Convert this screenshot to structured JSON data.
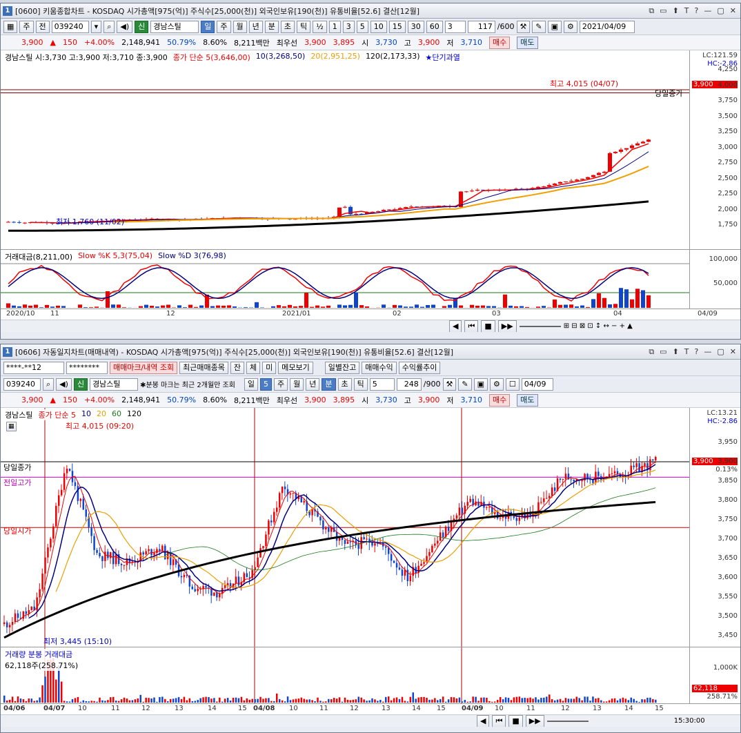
{
  "win1": {
    "num": "1",
    "title": "[0600] 키움종합차트 - KOSDAQ 시가총액[975(억)] 주식수[25,000(천)] 외국인보유[190(천)] 유통비율[52.6] 결산[12월]",
    "ctrl": [
      "⧉",
      "▭",
      "⬆",
      "T",
      "?",
      "—",
      "▢",
      "✕"
    ],
    "toolbar": {
      "type": "주",
      "sel": "전",
      "code": "039240",
      "stock": "경남스틸",
      "badge": "신",
      "periods": [
        "일",
        "주",
        "월",
        "년",
        "분",
        "초",
        "틱"
      ],
      "frac": "½",
      "nums": [
        "1",
        "3",
        "5",
        "10",
        "15",
        "30",
        "60"
      ],
      "num_sel": "3",
      "count": "117",
      "count_total": "/600",
      "date": "2021/04/09"
    },
    "quote": {
      "price": "3,900",
      "arrow": "▲",
      "change": "150",
      "pct": "+4.00%",
      "volume": "2,148,941",
      "rate1": "50.79%",
      "rate2": "8.60%",
      "amount": "8,211백만",
      "best_lbl": "최우선",
      "ask": "3,900",
      "bid": "3,895",
      "open_lbl": "시",
      "open": "3,730",
      "high_lbl": "고",
      "high": "3,900",
      "low_lbl": "저",
      "low": "3,710",
      "buy": "매수",
      "sell": "매도"
    },
    "legend": {
      "info": "경남스틸 시:3,730 고:3,900 저:3,710 종:3,900",
      "ma5": "종가 단순 5(3,646,00)",
      "ma10": "10(3,268,50)",
      "ma20": "20(2,951,25)",
      "ma120": "120(2,173,33)",
      "signal": "★단기과열"
    },
    "lc": "LC:121.59",
    "hc": "HC:-2.86",
    "ticks": [
      "4,250",
      "4,000",
      "3,750",
      "3,500",
      "3,250",
      "3,000",
      "2,750",
      "2,500",
      "2,250",
      "2,000",
      "1,750"
    ],
    "price_box": "3,900",
    "hi_anno": "최고 4,015 (04/07)",
    "lo_anno": "최저 1,760 (11/02)",
    "close_anno": "당일종가",
    "sub_legend": {
      "amt": "거래대금(8,211,00)",
      "k": "Slow %K 5,3(75,04)",
      "d": "Slow %D 3(76,98)"
    },
    "sub_ticks": [
      "100,000",
      "50,000"
    ],
    "dates": [
      "2020/10",
      "11",
      "12",
      "2021/01",
      "02",
      "03",
      "04"
    ],
    "date_last": "04/09"
  },
  "win2": {
    "num": "1",
    "title": "[0606] 자동일지차트(매매내역) - KOSDAQ 시가총액[975(억)] 주식수[25,000(천)] 외국인보유[190(천)] 유통비율[52.6] 결산[12월]",
    "ctrl": [
      "⧉",
      "▭",
      "⬆",
      "T",
      "?",
      "—",
      "▢",
      "✕"
    ],
    "row1": {
      "acct": "****-**12",
      "pw": "********",
      "b1": "매매마크/내역 조회",
      "b2": "최근매매종목",
      "b3": "잔",
      "b4": "체",
      "b5": "미",
      "b6": "메모보기",
      "b7": "일별잔고",
      "b8": "매매수익",
      "b9": "수익률추이"
    },
    "row2": {
      "code": "039240",
      "badge": "신",
      "stock": "경남스틸",
      "note": "✱분봉 마크는 최근 2개월만 조회",
      "periods": [
        "일",
        "5",
        "주",
        "월",
        "년",
        "분",
        "초",
        "틱"
      ],
      "num_sel": "5",
      "count": "248",
      "count_total": "/900",
      "date": "04/09"
    },
    "quote": {
      "price": "3,900",
      "arrow": "▲",
      "change": "150",
      "pct": "+4.00%",
      "volume": "2,148,941",
      "rate1": "50.79%",
      "rate2": "8.60%",
      "amount": "8,211백만",
      "best_lbl": "최우선",
      "ask": "3,900",
      "bid": "3,895",
      "open_lbl": "시",
      "open": "3,730",
      "high_lbl": "고",
      "high": "3,900",
      "low_lbl": "저",
      "low": "3,710",
      "buy": "매수",
      "sell": "매도"
    },
    "legend": {
      "name": "경남스틸",
      "ma": "종가 단순 5",
      "m10": "10",
      "m20": "20",
      "m60": "60",
      "m120": "120"
    },
    "lc": "LC:13.21",
    "hc": "HC:-2.86",
    "ticks": [
      "3,950",
      "3,900",
      "3,850",
      "3,800",
      "3,750",
      "3,700",
      "3,650",
      "3,600",
      "3,550",
      "3,500",
      "3,450"
    ],
    "price_box": "3,900",
    "pct_box": "0.13%",
    "hi_anno": "최고 4,015 (09:20)",
    "lo_anno": "최저 3,445 (15:10)",
    "line_close": "당일종가",
    "line_prevhigh": "전일고가",
    "line_open": "당일시가",
    "vol_legend": {
      "v": "거래량",
      "amt": "분봉 거래대금",
      "val": "62,118주(258.71%)"
    },
    "vol_tick": "1,000K",
    "vol_box": "62,118",
    "vol_pct": "258.71%",
    "dates": [
      "04/06",
      "04/07",
      "10",
      "11",
      "12",
      "13",
      "14",
      "15",
      "04/08",
      "10",
      "11",
      "12",
      "13",
      "14",
      "15",
      "04/09",
      "10",
      "11",
      "12",
      "13",
      "14",
      "15"
    ],
    "time": "15:30:00"
  }
}
